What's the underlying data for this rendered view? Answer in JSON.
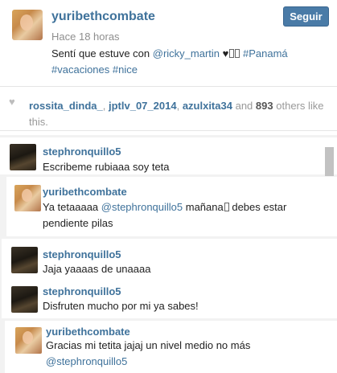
{
  "post": {
    "username": "yuribethcombate",
    "time_ago": "Hace 18 horas",
    "follow_label": "Seguir",
    "caption": {
      "text": "Sentí que estuve con ",
      "mention": "@ricky_martin",
      "heart": "♥",
      "hashtags": [
        "#Panamá",
        "#vacaciones",
        "#nice"
      ]
    }
  },
  "likes": {
    "heart": "♥",
    "likers": [
      "rossita_dinda_",
      "jptlv_07_2014",
      "azulxita34"
    ],
    "and_word": "and",
    "count": "893",
    "suffix": "others like this."
  },
  "comments": [
    {
      "username": "stephronquillo5",
      "text": "Escribeme rubiaaa soy teta"
    },
    {
      "username": "yuribethcombate",
      "text_before": "Ya tetaaaaa ",
      "mention": "@stephronquillo5",
      "text_after": " mañana",
      "text_end": " debes estar pendiente pilas"
    },
    {
      "username": "stephronquillo5",
      "text": "Jaja yaaaas de unaaaa"
    },
    {
      "username": "stephronquillo5",
      "text": "Disfruten mucho por mi ya sabes!"
    },
    {
      "username": "yuribethcombate",
      "text": "Gracias mi tetita jajaj un nivel medio no más ",
      "mention": "@stephronquillo5"
    }
  ],
  "colors": {
    "link": "#3f729b",
    "button": "#4a7ba7",
    "comments_bg": "#f2f2f2"
  }
}
